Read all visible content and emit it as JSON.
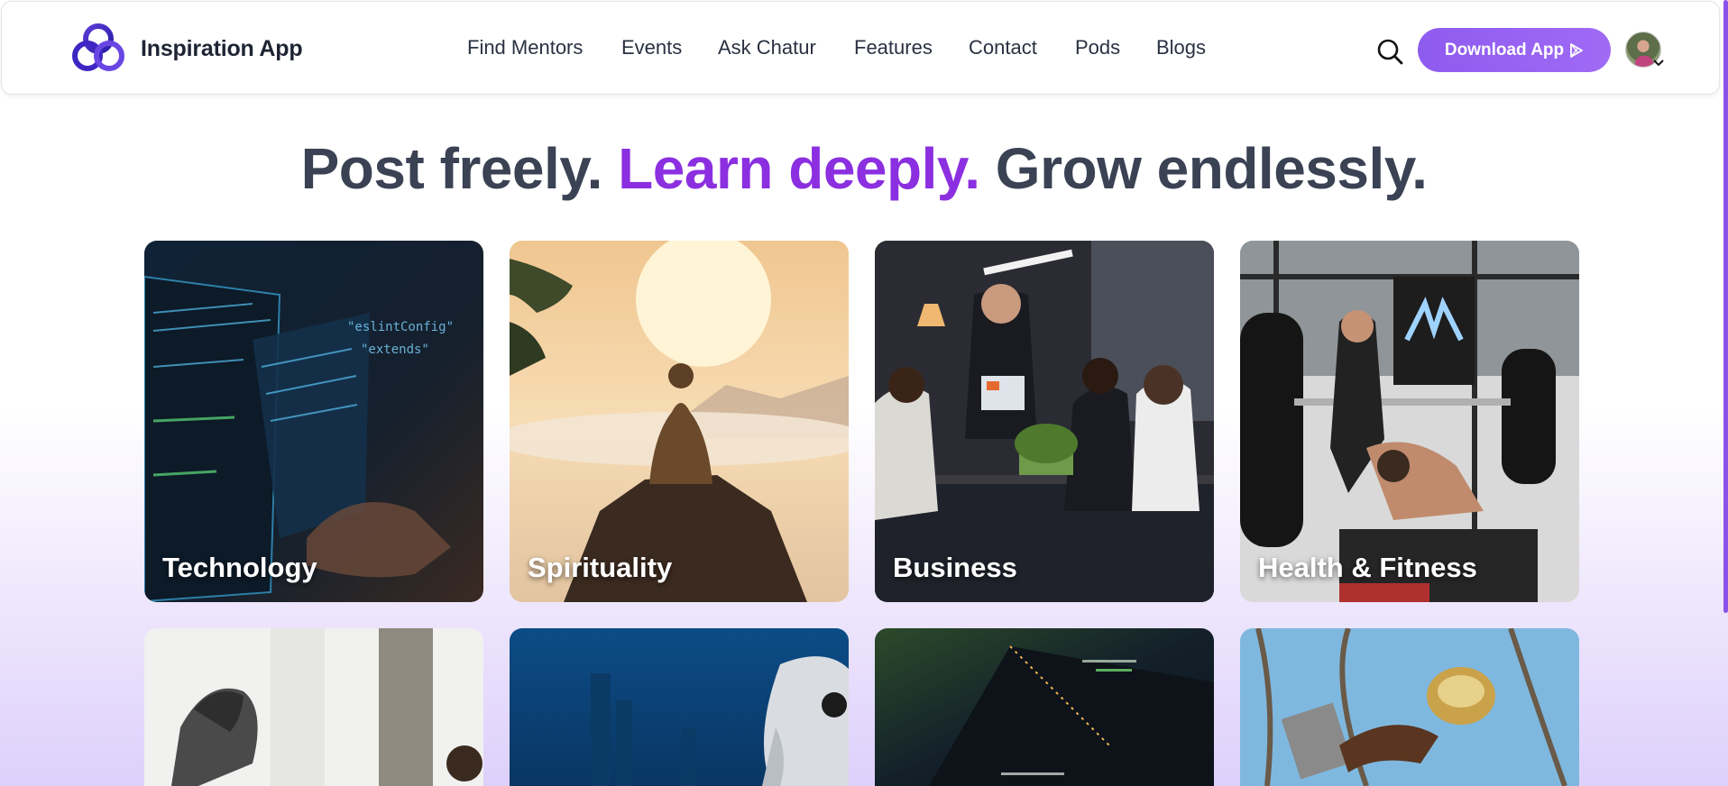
{
  "header": {
    "brand": "Inspiration App",
    "nav": [
      "Find Mentors",
      "Events",
      "Ask Chatur",
      "Features",
      "Contact",
      "Pods",
      "Blogs"
    ],
    "download_label": "Download App"
  },
  "headline": {
    "part1": "Post freely.",
    "part2": "Learn deeply.",
    "part3": "Grow endlessly."
  },
  "categories": [
    "Technology",
    "Spirituality",
    "Business",
    "Health & Fitness"
  ],
  "colors": {
    "accent": "#8b2fe0",
    "button": "#9461f2",
    "heading": "#3a4254"
  }
}
